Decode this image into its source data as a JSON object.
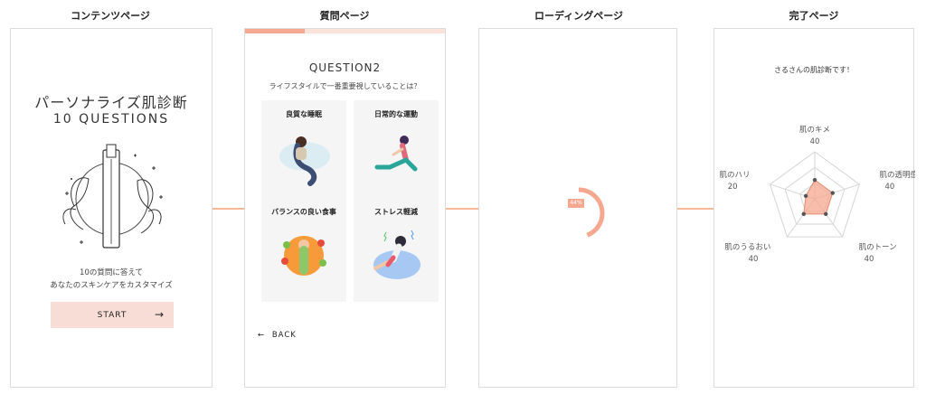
{
  "screens": {
    "content": {
      "title": "コンテンツページ"
    },
    "question": {
      "title": "質問ページ"
    },
    "loading": {
      "title": "ローディングページ"
    },
    "complete": {
      "title": "完了ページ"
    }
  },
  "content_page": {
    "title": "パーソナライズ肌診断",
    "subtitle": "10 QUESTIONS",
    "desc_line1": "10の質問に答えて",
    "desc_line2": "あなたのスキンケアをカスタマイズ",
    "start_label": "START",
    "start_icon": "→"
  },
  "question_page": {
    "progress": 0.3,
    "question_number": "QUESTION2",
    "question_text": "ライフスタイルで一番重要視していることは？",
    "options": [
      {
        "label": "良質な睡眠"
      },
      {
        "label": "日常的な運動"
      },
      {
        "label": "バランスの良い食事"
      },
      {
        "label": "ストレス軽減"
      }
    ],
    "back_label": "BACK",
    "back_icon": "←"
  },
  "loading_page": {
    "percent_text": "44%",
    "progress": 0.44
  },
  "complete_page": {
    "title": "さるさんの肌診断です！",
    "radar": [
      {
        "label": "肌のキメ",
        "value": "40"
      },
      {
        "label": "肌の透明感",
        "value": "40"
      },
      {
        "label": "肌のトーン",
        "value": "40"
      },
      {
        "label": "肌のうるおい",
        "value": "40"
      },
      {
        "label": "肌のハリ",
        "value": "20"
      }
    ],
    "radar_fill_color": "#f6a78f"
  },
  "colors": {
    "accent": "#f6a78f",
    "accent_light": "#f8ddd6",
    "arrow": "#e8762d"
  }
}
